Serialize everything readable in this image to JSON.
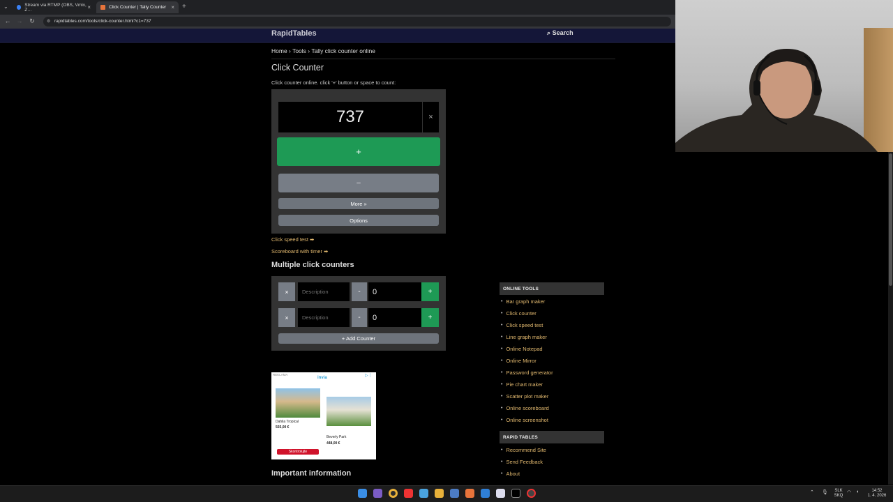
{
  "browser": {
    "tabs": [
      {
        "title": "Stream via RTMP (OBS, Vmix, Z…",
        "active": false
      },
      {
        "title": "Click Counter | Tally Counter",
        "active": true
      }
    ],
    "url": "rapidtables.com/tools/click-counter.html?c1=737"
  },
  "site": {
    "brand": "RapidTables",
    "search_label": "Search",
    "breadcrumb": "Home › Tools › Tally click counter online",
    "title": "Click Counter",
    "subtitle": "Click counter online. click '+' button or space to count:"
  },
  "counter": {
    "value": "737",
    "reset_label": "×",
    "plus_label": "+",
    "minus_label": "–",
    "more_label": "More »",
    "options_label": "Options"
  },
  "links": {
    "speed_test": "Click speed test ➡",
    "scoreboard": "Scoreboard with timer ➡"
  },
  "multi": {
    "heading": "Multiple click counters",
    "rows": [
      {
        "remove": "×",
        "placeholder": "Description",
        "minus": "-",
        "value": "0",
        "plus": "+"
      },
      {
        "remove": "×",
        "placeholder": "Description",
        "minus": "-",
        "value": "0",
        "plus": "+"
      }
    ],
    "add_label": "+ Add Counter"
  },
  "ad": {
    "tag": "REKLAMA",
    "brand": "invia",
    "hotel1_name": "Dahlia Tropical",
    "hotel1_price": "503,00 €",
    "hotel2_name": "Beverly Park",
    "hotel2_price": "448,00 €",
    "cta": "Skontrolujte"
  },
  "important_heading": "Important information",
  "sidebar": {
    "online_tools_heading": "ONLINE TOOLS",
    "online_tools": [
      "Bar graph maker",
      "Click counter",
      "Click speed test",
      "Line graph maker",
      "Online Notepad",
      "Online Mirror",
      "Password generator",
      "Pie chart maker",
      "Scatter plot maker",
      "Online scoreboard",
      "Online screenshot"
    ],
    "rapid_tables_heading": "RAPID TABLES",
    "rapid_tables": [
      "Recommend Site",
      "Send Feedback",
      "About"
    ]
  },
  "taskbar": {
    "lang_top": "SLK",
    "lang_bottom": "SKQ",
    "time": "14:52",
    "date": "1. 4. 2026"
  },
  "colors": {
    "green": "#1e9a55",
    "grey_button": "#777d86",
    "link": "#e2b96f",
    "header_bg": "#141638"
  }
}
